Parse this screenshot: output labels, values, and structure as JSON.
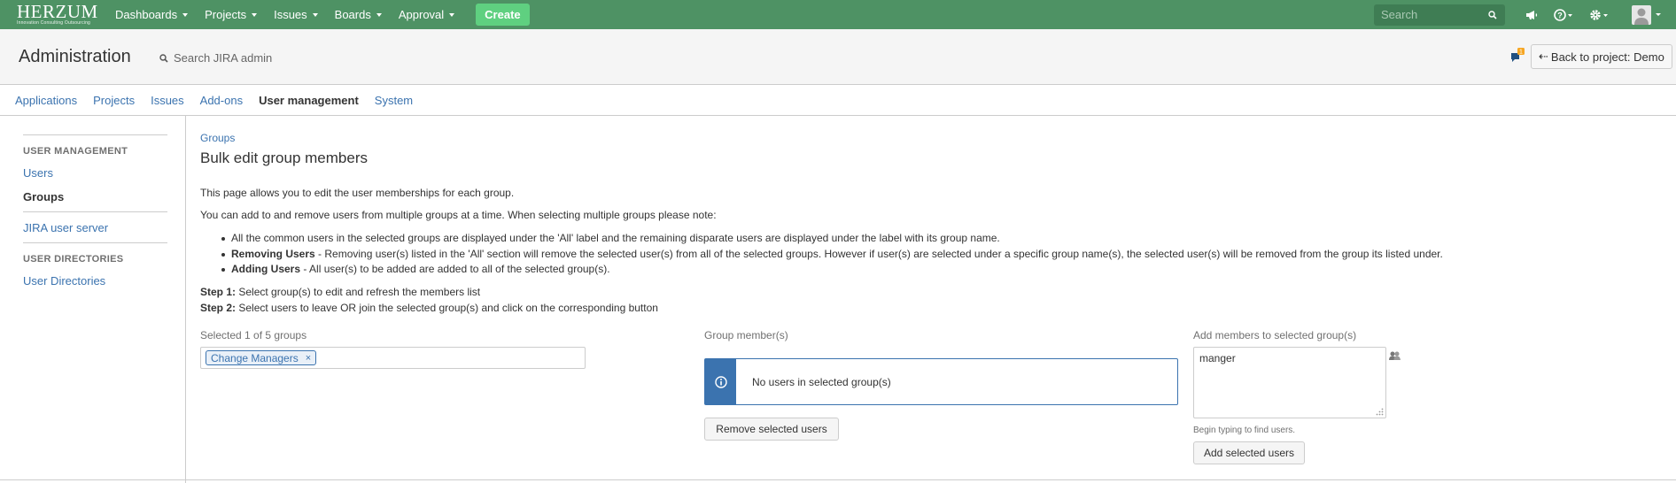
{
  "topnav": {
    "logo_word": "HERZUM",
    "logo_tagline": "Innovation Consulting Outsourcing",
    "items": [
      {
        "label": "Dashboards"
      },
      {
        "label": "Projects"
      },
      {
        "label": "Issues"
      },
      {
        "label": "Boards"
      },
      {
        "label": "Approval"
      }
    ],
    "create_label": "Create",
    "search_placeholder": "Search"
  },
  "header": {
    "title": "Administration",
    "search_placeholder": "Search JIRA admin",
    "notification_count": "1",
    "back_button": "Back to project: Demo"
  },
  "tabs": [
    {
      "label": "Applications"
    },
    {
      "label": "Projects"
    },
    {
      "label": "Issues"
    },
    {
      "label": "Add-ons"
    },
    {
      "label": "User management"
    },
    {
      "label": "System"
    }
  ],
  "sidebar": {
    "section1_heading": "USER MANAGEMENT",
    "users_link": "Users",
    "groups_link": "Groups",
    "jira_user_server": "JIRA user server",
    "section2_heading": "USER DIRECTORIES",
    "user_directories": "User Directories"
  },
  "main": {
    "breadcrumb": "Groups",
    "title": "Bulk edit group members",
    "intro": "This page allows you to edit the user memberships for each group.",
    "note": "You can add to and remove users from multiple groups at a time. When selecting multiple groups please note:",
    "bullet1": "All the common users in the selected groups are displayed under the 'All' label and the remaining disparate users are displayed under the label with its group name.",
    "bullet2_bold": "Removing Users",
    "bullet2_rest": " - Removing user(s) listed in the 'All' section will remove the selected user(s) from all of the selected groups. However if user(s) are selected under a specific group name(s), the selected user(s) will be removed from the group its listed under.",
    "bullet3_bold": "Adding Users",
    "bullet3_rest": " - All user(s) to be added are added to all of the selected group(s).",
    "step1_bold": "Step 1:",
    "step1_rest": " Select group(s) to edit and refresh the members list",
    "step2_bold": "Step 2:",
    "step2_rest": " Select users to leave OR join the selected group(s) and click on the corresponding button",
    "selected_label": "Selected 1 of 5 groups",
    "selected_chip": "Change Managers",
    "chip_remove": "×",
    "members_label": "Group member(s)",
    "no_users": "No users in selected group(s)",
    "remove_button": "Remove selected users",
    "add_label": "Add members to selected group(s)",
    "add_value": "manger",
    "helper": "Begin typing to find users.",
    "add_button": "Add selected users"
  }
}
